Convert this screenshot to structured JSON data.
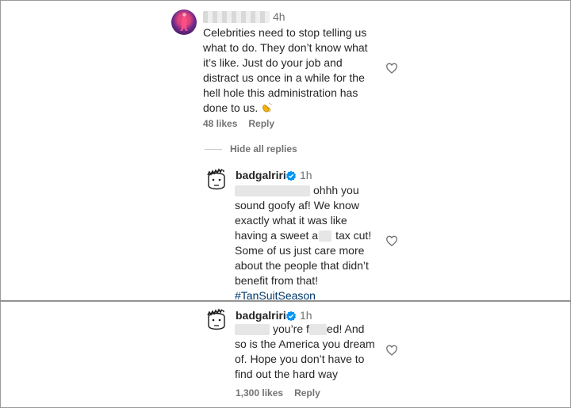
{
  "comment1": {
    "time": "4h",
    "lines": [
      "Celebrities need to stop telling us",
      "what to do. They don’t know what",
      "it’s like. Just do your job and",
      "distract us once in a while for the",
      "hell hole this administration has",
      "done to us."
    ],
    "emoji_icon": "clapping-hands-icon",
    "likes": "48 likes",
    "reply": "Reply",
    "hide_replies": "Hide all replies"
  },
  "reply1": {
    "username": "badgalriri",
    "time": "1h",
    "lines": [
      "ohhh you",
      "sound goofy af! We know",
      "exactly what it was like",
      "having a sweet a",
      "tax cut!",
      "Some of us just care more",
      "about the people that didn’t",
      "benefit from that!"
    ],
    "hashtag": "#TanSuitSeason"
  },
  "reply2": {
    "username": "badgalriri",
    "time": "1h",
    "line1_a": "you’re f",
    "line1_b": "ed! And",
    "lines": [
      "so is the America you dream",
      "of. Hope you don’t have to",
      "find out the hard way"
    ],
    "likes": "1,300 likes",
    "reply": "Reply"
  },
  "colors": {
    "text": "#262626",
    "secondary": "#737373",
    "verified": "#0095f6",
    "hashtag": "#00376b"
  }
}
